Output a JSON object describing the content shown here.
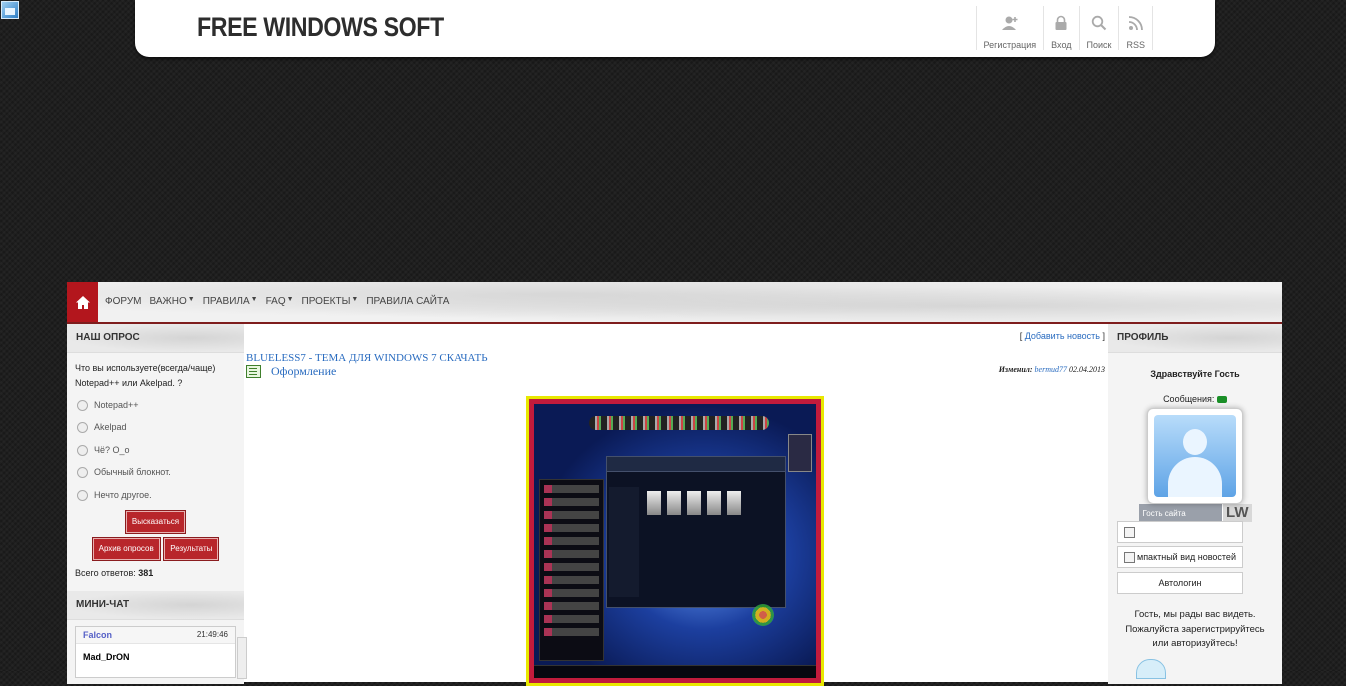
{
  "site": {
    "logo": "FREE WINDOWS SOFT",
    "top_nav": [
      {
        "label": "Регистрация",
        "icon": "add-user-icon"
      },
      {
        "label": "Вход",
        "icon": "lock-icon"
      },
      {
        "label": "Поиск",
        "icon": "search-icon"
      },
      {
        "label": "RSS",
        "icon": "rss-icon"
      }
    ]
  },
  "menu": [
    {
      "label": "ФОРУМ",
      "has_dropdown": false
    },
    {
      "label": "ВАЖНО",
      "has_dropdown": true
    },
    {
      "label": "ПРАВИЛА",
      "has_dropdown": true
    },
    {
      "label": "FAQ",
      "has_dropdown": true
    },
    {
      "label": "ПРОЕКТЫ",
      "has_dropdown": true
    },
    {
      "label": "ПРАВИЛА САЙТА",
      "has_dropdown": false
    }
  ],
  "poll": {
    "title": "НАШ ОПРОС",
    "question": "Что вы используете(всегда/чаще) Notepad++ или Akelpad. ?",
    "options": [
      "Notepad++",
      "Akelpad",
      "Чё? О_о",
      "Обычный блокнот.",
      "Нечто другое."
    ],
    "vote_button": "Высказаться",
    "archive_button": "Архив опросов",
    "results_button": "Результаты",
    "total_label": "Всего ответов:",
    "total_value": "381"
  },
  "chat": {
    "title": "МИНИ-ЧАТ",
    "user": "Falcon",
    "time": "21:49:46",
    "message": "Mad_DrON"
  },
  "news": {
    "add_link": "Добавить новость",
    "title": "BLUELESS7 - ТЕМА ДЛЯ WINDOWS 7 СКАЧАТЬ",
    "category": "Оформление",
    "edited_label": "Изменил:",
    "edited_by": "bermud77",
    "edited_date": "02.04.2013"
  },
  "profile": {
    "title": "ПРОФИЛЬ",
    "greeting": "Здравствуйте Гость",
    "messages_label": "Сообщения:",
    "guest_label": "Гость сайта",
    "badge": "LW",
    "compact_label": "мпактный вид новостей",
    "autologin_button": "Автологин",
    "welcome_text": "Гость, мы рады вас видеть.",
    "register_text": "Пожалуйста зарегистрируйтесь",
    "login_text": "или авторизуйтесь!"
  },
  "colors": {
    "accent": "#b3161d",
    "link": "#2a6cc0",
    "background": "#1f1f1f"
  }
}
